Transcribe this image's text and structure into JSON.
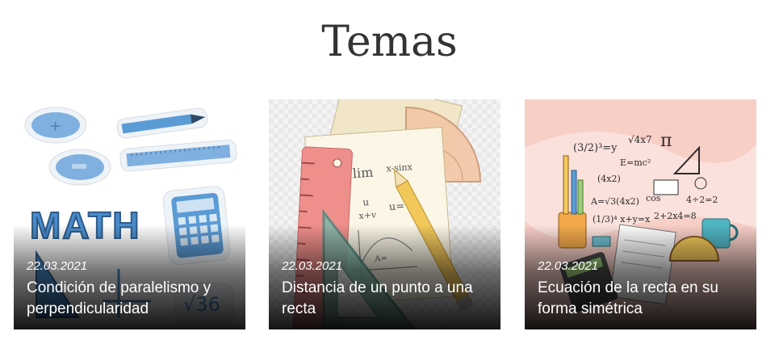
{
  "section": {
    "title": "Temas"
  },
  "cards": [
    {
      "date": "22.03.2021",
      "title": "Condición de paralelismo y perpendicularidad",
      "image_text": "MATH"
    },
    {
      "date": "22.03.2021",
      "title": "Distancia de un punto a una recta"
    },
    {
      "date": "22.03.2021",
      "title": "Ecuación de la recta en su forma simétrica"
    }
  ],
  "colors": {
    "accent_blue": "#5b9bd5",
    "pink_bg": "#f8cfc7",
    "ruler_red": "#e88080",
    "text_dark": "#333333"
  }
}
